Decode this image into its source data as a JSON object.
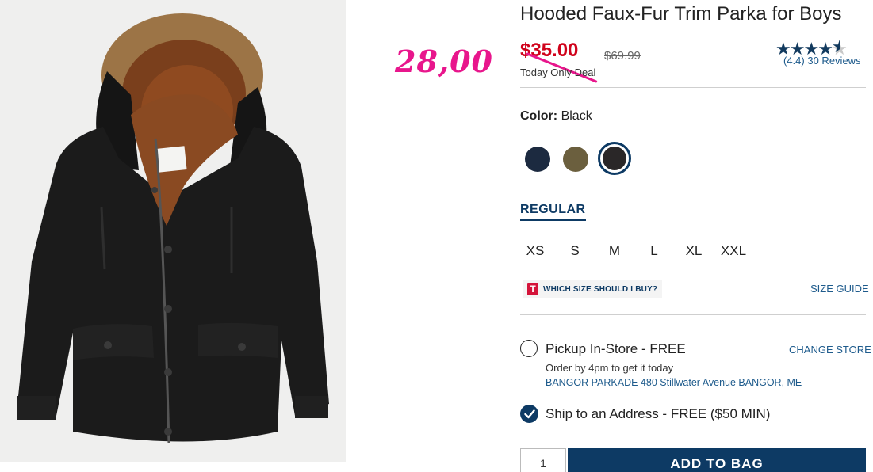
{
  "product": {
    "title": "Hooded Faux-Fur Trim Parka for Boys",
    "sale_price": "$35.00",
    "original_price": "$69.99",
    "deal_label": "Today Only Deal",
    "handwritten_price": "28,00",
    "rating_text": "(4.4)",
    "reviews_text": "30 Reviews",
    "rating_value": 4.4,
    "image_icon": "parka-photo"
  },
  "color": {
    "label": "Color:",
    "selected": "Black",
    "swatches": [
      {
        "name": "navy",
        "hex": "#1c2a40"
      },
      {
        "name": "olive",
        "hex": "#6b5f3e"
      },
      {
        "name": "black",
        "hex": "#2a2728"
      }
    ],
    "selected_ring": "#0d3a64"
  },
  "sizes": {
    "group_tab": "REGULAR",
    "options": [
      "XS",
      "S",
      "M",
      "L",
      "XL",
      "XXL"
    ],
    "help_icon": "T",
    "help_label": "WHICH SIZE SHOULD I BUY?",
    "guide_link": "SIZE GUIDE"
  },
  "fulfillment": {
    "pickup_label": "Pickup In-Store - FREE",
    "change_store": "CHANGE STORE",
    "pickup_note": "Order by 4pm to get it today",
    "store_address": "BANGOR PARKADE 480 Stillwater Avenue  BANGOR, ME",
    "ship_label": "Ship to an Address - FREE ($50 MIN)",
    "ship_selected": true
  },
  "cart": {
    "qty": "1",
    "add_label": "ADD TO BAG"
  },
  "colors": {
    "brand_navy": "#0d3a64",
    "sale_red": "#d0021b",
    "annotation_pink": "#e8168c",
    "link_blue": "#1e5b8c"
  }
}
